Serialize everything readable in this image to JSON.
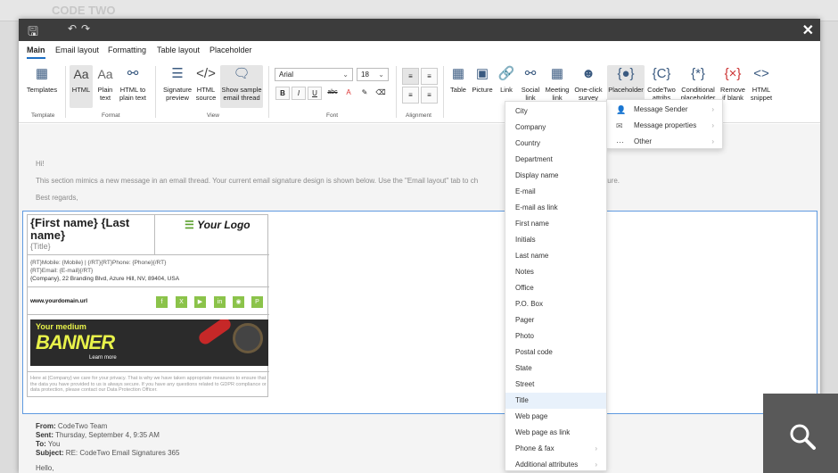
{
  "ribbon_tabs": [
    "Main",
    "Email layout",
    "Formatting",
    "Table layout",
    "Placeholder"
  ],
  "groups": {
    "template": {
      "label": "Template",
      "btn": "Templates"
    },
    "format": {
      "label": "Format",
      "html": "HTML",
      "plain": "Plain text",
      "html_to_plain": "HTML to plain text"
    },
    "view": {
      "label": "View",
      "sig_preview": "Signature preview",
      "html_source": "HTML source",
      "show_thread": "Show sample email thread"
    },
    "font": {
      "label": "Font",
      "family": "Arial",
      "size": "18"
    },
    "alignment": {
      "label": "Alignment"
    },
    "insert": {
      "table": "Table",
      "picture": "Picture",
      "link": "Link",
      "social": "Social link",
      "meeting": "Meeting link",
      "survey": "One-click survey",
      "placeholder": "Placeholder",
      "codetwo": "CodeTwo attribs",
      "conditional": "Conditional placeholder",
      "remove_blank": "Remove if blank",
      "html_snippet": "HTML snippet"
    }
  },
  "message": {
    "greeting": "Hi!",
    "body": "This section mimics a new message in an email thread. Your current email signature design is shown below. Use the \"Email layout\" tab to ch",
    "body_tail": "ture.",
    "signoff": "Best regards,"
  },
  "signature": {
    "name": "{First name} {Last name}",
    "title": "{Title}",
    "logo": "Your Logo",
    "mobile_line": "{RT}Mobile: {Mobile} | {/RT}{RT}Phone: {Phone}{/RT}",
    "email_line": "{RT}Email: {E-mail}{/RT}",
    "company_line": "{Company}, 22 Branding Blvd, Azure Hill, NV, 89404, USA",
    "website": "www.yourdomain.url",
    "banner_top": "Your medium",
    "banner_big": "BANNER",
    "banner_link": "Learn more",
    "disclaimer": "Here at {Company} we care for your privacy. That is why we have taken appropriate measures to ensure that the data you have provided to us is always secure. If you have any questions related to GDPR compliance or data protection, please contact our Data Protection Officer."
  },
  "quoted": {
    "from_label": "From:",
    "from": "CodeTwo Team",
    "sent_label": "Sent:",
    "sent": "Thursday, September 4, 9:35 AM",
    "to_label": "To:",
    "to": "You",
    "subject_label": "Subject:",
    "subject": "RE: CodeTwo Email Signatures 365",
    "hello": "Hello,"
  },
  "placeholder_menu": [
    {
      "label": "Message Sender",
      "icon": "person-icon"
    },
    {
      "label": "Message properties",
      "icon": "envelope-icon"
    },
    {
      "label": "Other",
      "icon": "more-icon"
    }
  ],
  "attributes_menu": [
    "City",
    "Company",
    "Country",
    "Department",
    "Display name",
    "E-mail",
    "E-mail as link",
    "First name",
    "Initials",
    "Last name",
    "Notes",
    "Office",
    "P.O. Box",
    "Pager",
    "Photo",
    "Postal code",
    "State",
    "Street",
    "Title",
    "Web page",
    "Web page as link",
    "Phone & fax",
    "Additional attributes"
  ],
  "highlighted_attribute": "Title",
  "accent_color": "#1d6fc4",
  "social_color": "#8bc34a"
}
